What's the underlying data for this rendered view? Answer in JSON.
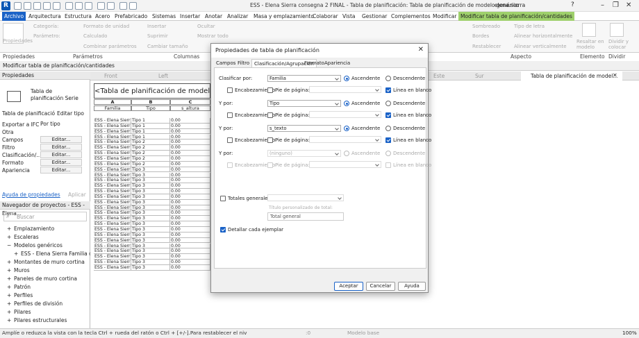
{
  "window": {
    "title": "ESS - Elena Sierra consegna 2 FINAL - Tabla de planificación: Tabla de planificación de modelo genérico",
    "user": "elena.sierra",
    "help": "?"
  },
  "ribbon": {
    "tabs": [
      "Archivo",
      "Arquitectura",
      "Estructura",
      "Acero",
      "Prefabricado",
      "Sistemas",
      "Insertar",
      "Anotar",
      "Analizar",
      "Masa y emplazamiento",
      "Colaborar",
      "Vista",
      "Gestionar",
      "Complementos",
      "Modificar",
      "Modificar tabla de planificación/cantidades"
    ],
    "groups": {
      "propiedades": "Propiedades",
      "parametros": "Parámetros",
      "columnas": "Columnas",
      "aspecto": "Aspecto",
      "elemento": "Elemento",
      "dividir": "Dividir"
    },
    "items": {
      "categoria": "Categoría:",
      "parametro": "Parámetro:",
      "formato_unidad": "Formato de unidad",
      "calculado": "Calculado",
      "combinar": "Combinar parámetros",
      "insertar": "Insertar",
      "suprimir": "Suprimir",
      "cambiar_tamano": "Cambiar tamaño",
      "ocultar": "Ocultar",
      "mostrar_todo": "Mostrar todo",
      "propiedades_btn": "Propiedades",
      "sombreado": "Sombreado",
      "tipo_letra": "Tipo de letra",
      "bordes": "Bordes",
      "alinear_h": "Alinear horizontalmente",
      "restablecer": "Restablecer",
      "alinear_v": "Alinear verticalmente",
      "resaltar": "Resaltar en modelo",
      "dividir_colocar": "Dividir y colocar"
    }
  },
  "context_bar": "Modificar tabla de planificación/cantidades",
  "properties_panel": {
    "header": "Propiedades",
    "type_name": "Tabla de planificación Serie",
    "type_selector": "Tabla de planificació",
    "edit_type": "Editar tipo",
    "rows": [
      {
        "label": "Exportar a IFC",
        "value": "Por tipo"
      },
      {
        "label": "Otra",
        "value": ""
      },
      {
        "label": "Campos",
        "value": "Editar..."
      },
      {
        "label": "Filtro",
        "value": "Editar..."
      },
      {
        "label": "Clasificación/...",
        "value": "Editar..."
      },
      {
        "label": "Formato",
        "value": "Editar..."
      },
      {
        "label": "Apariencia",
        "value": "Editar..."
      }
    ],
    "help_link": "Ayuda de propiedades",
    "apply": "Aplicar"
  },
  "project_browser": {
    "header": "Navegador de proyectos - ESS - Elena...",
    "search_placeholder": "Buscar",
    "items": [
      "Emplazamiento",
      "Escaleras",
      "Modelos genéricos",
      "ESS - Elena Sierra Familia cc",
      "Montantes de muro cortina",
      "Muros",
      "Paneles de muro cortina",
      "Patrón",
      "Perfiles",
      "Perfiles de división",
      "Pilares",
      "Pilares estructurales"
    ]
  },
  "doc_tabs": [
    "Front",
    "Left",
    "Este",
    "Sur",
    "Tabla de planificación de model..."
  ],
  "schedule": {
    "title": "<Tabla de planificación de modelo genérico>",
    "col_letters": [
      "A",
      "B",
      "C"
    ],
    "col_names": [
      "Familia",
      "Tipo",
      "s_altura"
    ],
    "rows": [
      [
        "ESS - Elena Sierra",
        "Tipo 1",
        "0.00"
      ],
      [
        "ESS - Elena Sierra",
        "Tipo 1",
        "0.00"
      ],
      [
        "ESS - Elena Sierra",
        "Tipo 1",
        "0.00"
      ],
      [
        "ESS - Elena Sierra",
        "Tipo 1",
        "0.00"
      ],
      [
        "ESS - Elena Sierra",
        "Tipo 2",
        "0.00"
      ],
      [
        "ESS - Elena Sierra",
        "Tipo 2",
        "0.00"
      ],
      [
        "ESS - Elena Sierra",
        "Tipo 2",
        "0.00"
      ],
      [
        "ESS - Elena Sierra",
        "Tipo 2",
        "0.00"
      ],
      [
        "ESS - Elena Sierra",
        "Tipo 2",
        "0.00"
      ],
      [
        "ESS - Elena Sierra",
        "Tipo 3",
        "0.00"
      ],
      [
        "ESS - Elena Sierra",
        "Tipo 3",
        "0.00"
      ],
      [
        "ESS - Elena Sierra",
        "Tipo 3",
        "0.00"
      ],
      [
        "ESS - Elena Sierra",
        "Tipo 3",
        "0.00"
      ],
      [
        "ESS - Elena Sierra",
        "Tipo 3",
        "0.00"
      ],
      [
        "ESS - Elena Sierra",
        "Tipo 3",
        "0.00"
      ],
      [
        "ESS - Elena Sierra",
        "Tipo 3",
        "0.00"
      ],
      [
        "ESS - Elena Sierra",
        "Tipo 3",
        "0.00"
      ],
      [
        "ESS - Elena Sierra",
        "Tipo 3",
        "0.00"
      ],
      [
        "ESS - Elena Sierra",
        "Tipo 3",
        "0.00"
      ],
      [
        "ESS - Elena Sierra",
        "Tipo 3",
        "0.00"
      ],
      [
        "ESS - Elena Sierra",
        "Tipo 3",
        "0.00"
      ],
      [
        "ESS - Elena Sierra",
        "Tipo 3",
        "0.00"
      ],
      [
        "ESS - Elena Sierra",
        "Tipo 3",
        "0.00"
      ],
      [
        "ESS - Elena Sierra",
        "Tipo 3",
        "0.00"
      ],
      [
        "ESS - Elena Sierra",
        "Tipo 3",
        "0.00"
      ],
      [
        "ESS - Elena Sierra",
        "Tipo 3",
        "0.00"
      ],
      [
        "ESS - Elena Sierra",
        "Tipo 3",
        "0.00"
      ],
      [
        "ESS - Elena Sierra",
        "Tipo 3",
        "0.00"
      ]
    ]
  },
  "dialog": {
    "title": "Propiedades de tabla de planificación",
    "tabs": [
      "Campos",
      "Filtro",
      "Clasificación/Agrupación",
      "Formato",
      "Apariencia"
    ],
    "sort_rows": [
      {
        "label": "Clasificar por:",
        "value": "Familia",
        "enabled": true,
        "header_chk": false,
        "footer_chk": false,
        "blank_line": true
      },
      {
        "label": "Y por:",
        "value": "Tipo",
        "enabled": true,
        "header_chk": false,
        "footer_chk": false,
        "blank_line": true
      },
      {
        "label": "Y por:",
        "value": "s_texto",
        "enabled": true,
        "header_chk": false,
        "footer_chk": false,
        "blank_line": true
      },
      {
        "label": "Y por:",
        "value": "(ninguno)",
        "enabled": false,
        "header_chk": false,
        "footer_chk": false,
        "blank_line": false
      }
    ],
    "ascendente": "Ascendente",
    "descendente": "Descendente",
    "encabezamiento": "Encabezamiento",
    "pie": "Pie de página:",
    "linea_blanco": "Línea en blanco",
    "totales": "Totales generales:",
    "titulo_personalizado": "Título personalizado de total:",
    "total_general": "Total general",
    "detallar": "Detallar cada ejemplar",
    "aceptar": "Aceptar",
    "cancelar": "Cancelar",
    "ayuda": "Ayuda"
  },
  "status": {
    "text": "Amplíe o reduzca la vista con la tecla Ctrl + rueda del ratón o Ctrl + [+/-].Para restablecer el niv",
    "model": "Modelo base",
    "zero": ":0",
    "zoom": "100%"
  }
}
